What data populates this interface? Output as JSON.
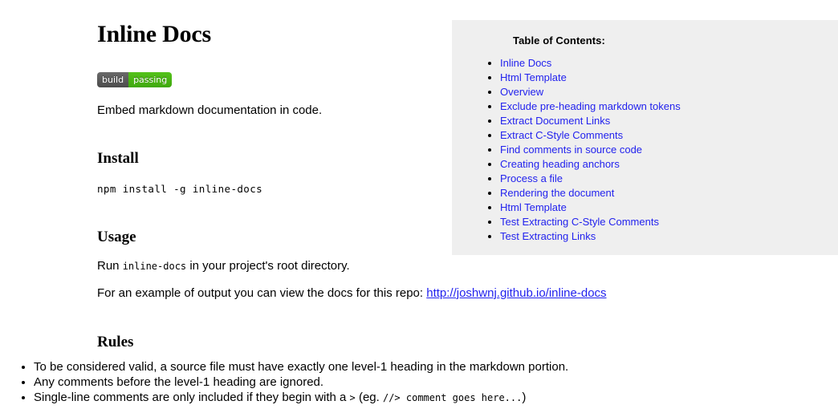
{
  "page": {
    "background_color": "#ffffff",
    "title": "Inline Docs"
  },
  "badge": {
    "label": "build",
    "status": "passing",
    "label_color": "#555555",
    "status_color": "#4cc11a"
  },
  "tagline": "Embed markdown documentation in code.",
  "sections": {
    "install": {
      "heading": "Install",
      "command": "npm install -g inline-docs"
    },
    "usage": {
      "heading": "Usage",
      "run_prefix": "Run ",
      "run_code": "inline-docs",
      "run_suffix": " in your project's root directory.",
      "example_prefix": "For an example of output you can view the docs for this repo: ",
      "example_link_text": "http://joshwnj.github.io/inline-docs",
      "link_color": "#2222ee"
    },
    "rules": {
      "heading": "Rules",
      "items": [
        {
          "parts": [
            {
              "type": "text",
              "value": "To be considered valid, a source file must have exactly one level-1 heading in the markdown portion."
            }
          ]
        },
        {
          "parts": [
            {
              "type": "text",
              "value": "Any comments before the level-1 heading are ignored."
            }
          ]
        },
        {
          "parts": [
            {
              "type": "text",
              "value": "Single-line comments are only included if they begin with a "
            },
            {
              "type": "code",
              "value": ">"
            },
            {
              "type": "text",
              "value": " (eg. "
            },
            {
              "type": "code",
              "value": "//> comment goes here..."
            },
            {
              "type": "text",
              "value": ")"
            }
          ]
        }
      ]
    }
  },
  "toc": {
    "title": "Table of Contents:",
    "background_color": "#efefef",
    "link_color": "#2222ee",
    "items": [
      {
        "label": "Inline Docs"
      },
      {
        "label": "Html Template"
      },
      {
        "label": "Overview"
      },
      {
        "label": "Exclude pre-heading markdown tokens"
      },
      {
        "label": "Extract Document Links"
      },
      {
        "label": "Extract C-Style Comments"
      },
      {
        "label": "Find comments in source code"
      },
      {
        "label": "Creating heading anchors"
      },
      {
        "label": "Process a file"
      },
      {
        "label": "Rendering the document"
      },
      {
        "label": "Html Template"
      },
      {
        "label": "Test Extracting C-Style Comments"
      },
      {
        "label": "Test Extracting Links"
      }
    ]
  }
}
